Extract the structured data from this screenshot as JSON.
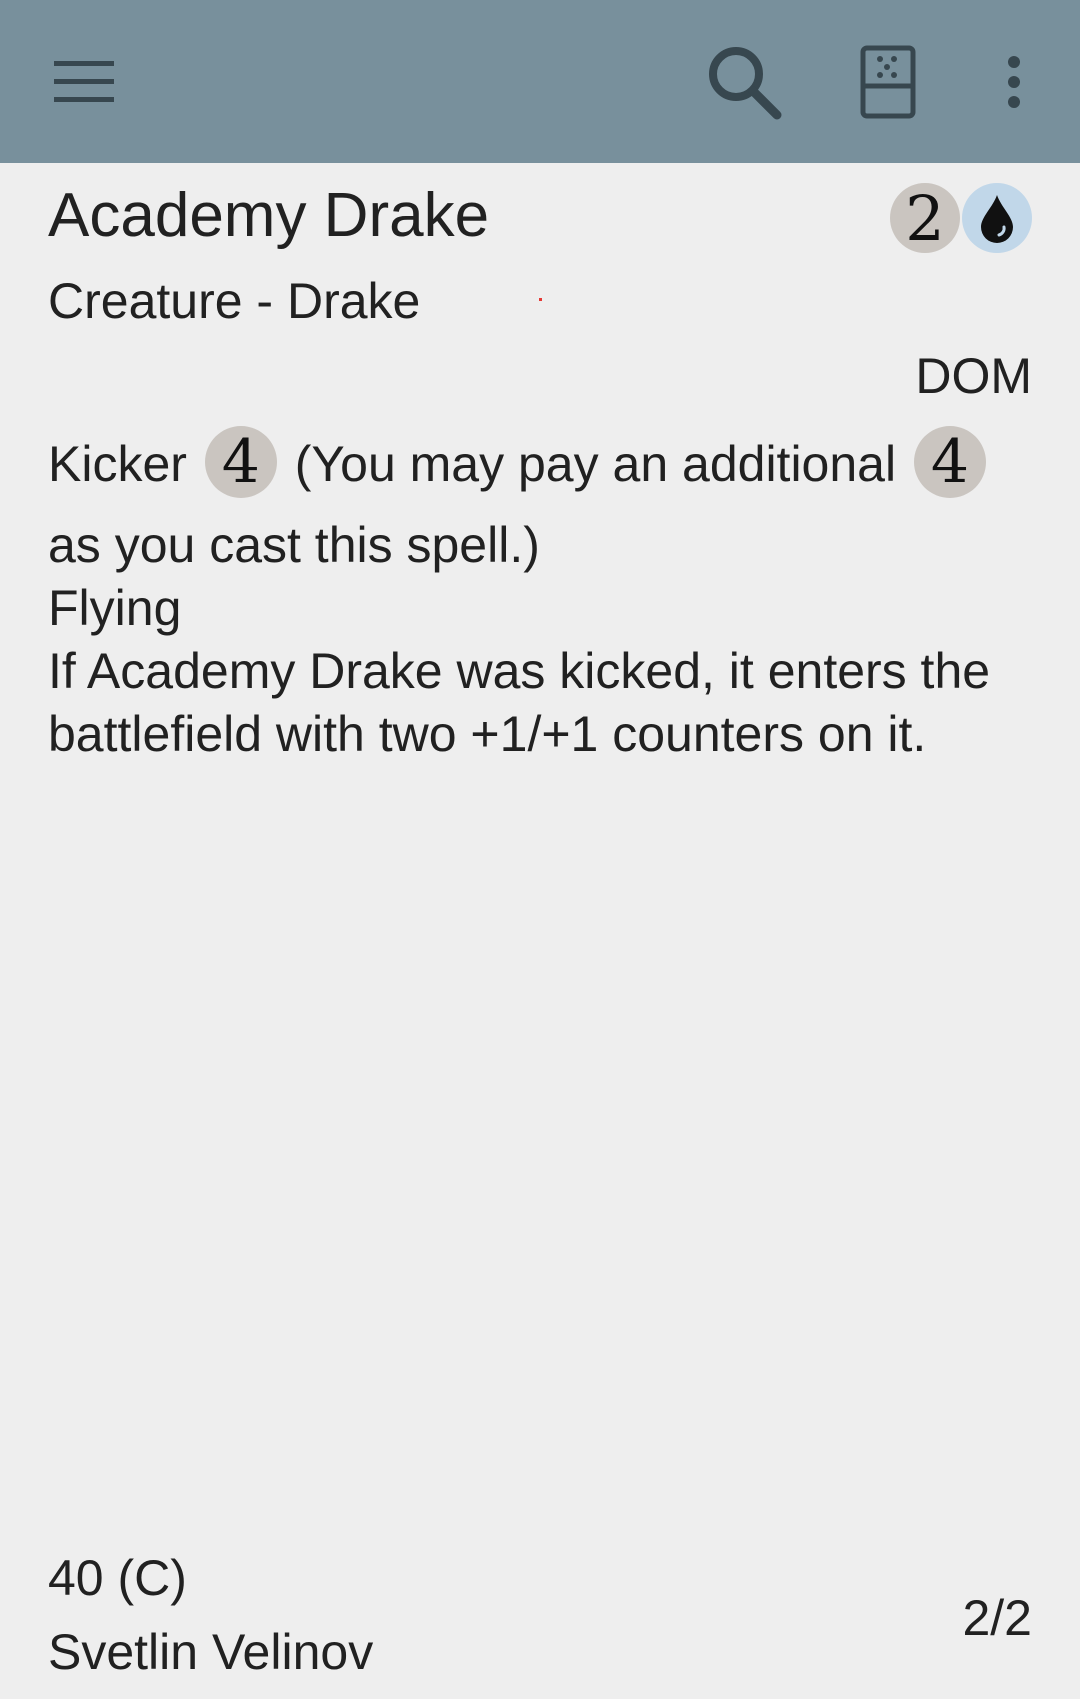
{
  "toolbar": {
    "background": "#78909c",
    "icons": {
      "menu": "hamburger-menu-icon",
      "search": "search-icon",
      "random": "dice-icon",
      "overflow": "more-vertical-icon"
    }
  },
  "card": {
    "name": "Academy Drake",
    "mana_cost": [
      {
        "symbol": "2",
        "type": "generic"
      },
      {
        "symbol": "U",
        "type": "blue"
      }
    ],
    "type_line": "Creature - Drake",
    "set": "DOM",
    "oracle": {
      "kicker_word": "Kicker",
      "kicker_cost": "4",
      "kicker_reminder_a": "(You may pay an additional",
      "kicker_reminder_cost": "4",
      "kicker_reminder_b": "as you cast this spell.)",
      "keyword": "Flying",
      "ability": "If Academy Drake was kicked, it enters the battlefield with two +1/+1 counters on it."
    },
    "collector_number": "40 (C)",
    "artist": "Svetlin Velinov",
    "power_toughness": "2/2"
  },
  "colors": {
    "generic_symbol": "#cac5c0",
    "blue_symbol": "#c1d7e9",
    "background": "#eeeeee",
    "text": "#212121"
  }
}
